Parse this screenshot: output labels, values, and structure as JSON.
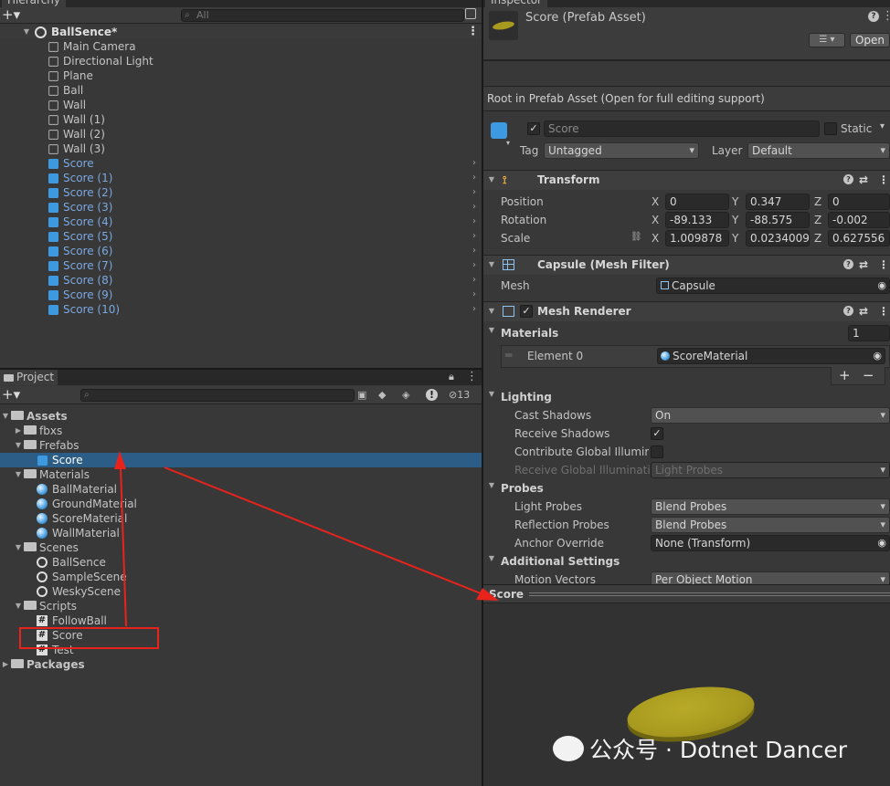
{
  "hierarchy": {
    "tab": "Hierarchy",
    "search_placeholder": "All",
    "scene": "BallSence*",
    "objects": [
      {
        "name": "Main Camera",
        "prefab": false
      },
      {
        "name": "Directional Light",
        "prefab": false
      },
      {
        "name": "Plane",
        "prefab": false
      },
      {
        "name": "Ball",
        "prefab": false
      },
      {
        "name": "Wall",
        "prefab": false
      },
      {
        "name": "Wall (1)",
        "prefab": false
      },
      {
        "name": "Wall (2)",
        "prefab": false
      },
      {
        "name": "Wall (3)",
        "prefab": false
      },
      {
        "name": "Score",
        "prefab": true
      },
      {
        "name": "Score (1)",
        "prefab": true
      },
      {
        "name": "Score (2)",
        "prefab": true
      },
      {
        "name": "Score (3)",
        "prefab": true
      },
      {
        "name": "Score (4)",
        "prefab": true
      },
      {
        "name": "Score (5)",
        "prefab": true
      },
      {
        "name": "Score (6)",
        "prefab": true
      },
      {
        "name": "Score (7)",
        "prefab": true
      },
      {
        "name": "Score (8)",
        "prefab": true
      },
      {
        "name": "Score (9)",
        "prefab": true
      },
      {
        "name": "Score (10)",
        "prefab": true
      }
    ]
  },
  "project": {
    "tab": "Project",
    "hidden_count": "13",
    "tree": [
      {
        "label": "Assets",
        "depth": 0,
        "kind": "folder-open",
        "bold": true
      },
      {
        "label": "fbxs",
        "depth": 1,
        "kind": "folder"
      },
      {
        "label": "Frefabs",
        "depth": 1,
        "kind": "folder-open"
      },
      {
        "label": "Score",
        "depth": 2,
        "kind": "prefab",
        "selected": true
      },
      {
        "label": "Materials",
        "depth": 1,
        "kind": "folder-open"
      },
      {
        "label": "BallMaterial",
        "depth": 2,
        "kind": "material"
      },
      {
        "label": "GroundMaterial",
        "depth": 2,
        "kind": "material"
      },
      {
        "label": "ScoreMaterial",
        "depth": 2,
        "kind": "material"
      },
      {
        "label": "WallMaterial",
        "depth": 2,
        "kind": "material"
      },
      {
        "label": "Scenes",
        "depth": 1,
        "kind": "folder-open"
      },
      {
        "label": "BallSence",
        "depth": 2,
        "kind": "scene"
      },
      {
        "label": "SampleScene",
        "depth": 2,
        "kind": "scene"
      },
      {
        "label": "WeskyScene",
        "depth": 2,
        "kind": "scene"
      },
      {
        "label": "Scripts",
        "depth": 1,
        "kind": "folder-open"
      },
      {
        "label": "FollowBall",
        "depth": 2,
        "kind": "script"
      },
      {
        "label": "Score",
        "depth": 2,
        "kind": "script"
      },
      {
        "label": "Test",
        "depth": 2,
        "kind": "script"
      },
      {
        "label": "Packages",
        "depth": 0,
        "kind": "folder",
        "bold": true
      }
    ]
  },
  "inspector": {
    "tab": "Inspector",
    "title": "Score (Prefab Asset)",
    "open_label": "Open",
    "root_note": "Root in Prefab Asset (Open for full editing support)",
    "object_name": "Score",
    "static_label": "Static",
    "tag_label": "Tag",
    "tag_value": "Untagged",
    "layer_label": "Layer",
    "layer_value": "Default",
    "transform": {
      "title": "Transform",
      "position_label": "Position",
      "rotation_label": "Rotation",
      "scale_label": "Scale",
      "x": "X",
      "y": "Y",
      "z": "Z",
      "position": [
        "0",
        "0.347",
        "0"
      ],
      "rotation": [
        "-89.133",
        "-88.575",
        "-0.002"
      ],
      "scale": [
        "1.009878",
        "0.0234009",
        "0.627556"
      ]
    },
    "mesh_filter": {
      "title": "Capsule (Mesh Filter)",
      "mesh_label": "Mesh",
      "mesh_value": "Capsule"
    },
    "mesh_renderer": {
      "title": "Mesh Renderer",
      "materials_label": "Materials",
      "materials_count": "1",
      "element_label": "Element 0",
      "element_value": "ScoreMaterial",
      "add": "+",
      "remove": "−",
      "lighting_label": "Lighting",
      "cast_shadows_label": "Cast Shadows",
      "cast_shadows_value": "On",
      "receive_shadows_label": "Receive Shadows",
      "contribute_gi_label": "Contribute Global Illumina",
      "receive_gi_label": "Receive Global Illuminatio",
      "receive_gi_value": "Light Probes",
      "probes_label": "Probes",
      "light_probes_label": "Light Probes",
      "light_probes_value": "Blend Probes",
      "reflection_probes_label": "Reflection Probes",
      "reflection_probes_value": "Blend Probes",
      "anchor_override_label": "Anchor Override",
      "anchor_override_value": "None (Transform)",
      "additional_label": "Additional Settings",
      "motion_vectors_label": "Motion Vectors",
      "motion_vectors_value": "Per Object Motion"
    },
    "preview_title": "Score",
    "watermark": "公众号 · Dotnet Dancer"
  },
  "colors": {
    "annotation": "#e8231c",
    "preview_disc": "#a89a1e",
    "selection": "#2c5d87",
    "prefab_text": "#7aa9e0"
  }
}
